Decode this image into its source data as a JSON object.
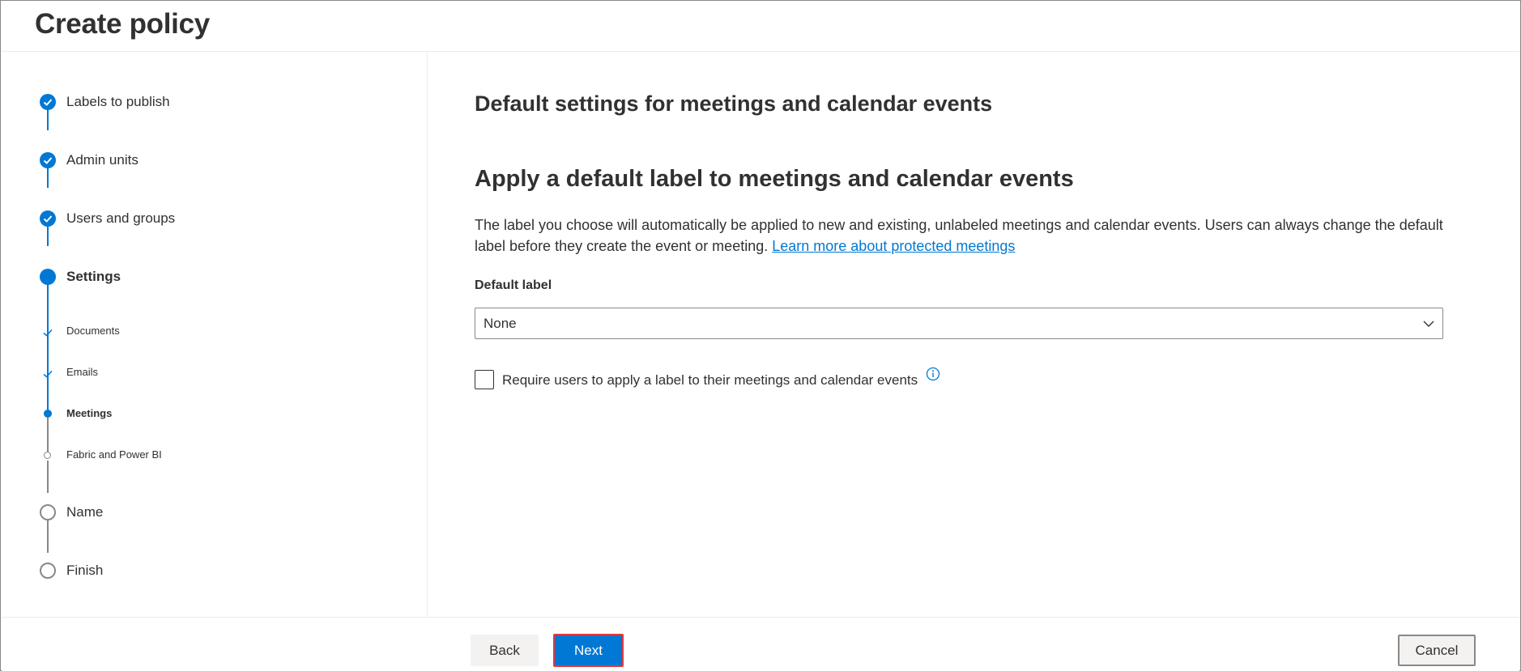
{
  "header": {
    "title": "Create policy"
  },
  "wizard": {
    "steps": [
      {
        "label": "Labels to publish",
        "state": "completed"
      },
      {
        "label": "Admin units",
        "state": "completed"
      },
      {
        "label": "Users and groups",
        "state": "completed"
      },
      {
        "label": "Settings",
        "state": "current"
      },
      {
        "label": "Documents",
        "state": "sub-completed"
      },
      {
        "label": "Emails",
        "state": "sub-completed"
      },
      {
        "label": "Meetings",
        "state": "sub-current"
      },
      {
        "label": "Fabric and Power BI",
        "state": "sub-pending"
      },
      {
        "label": "Name",
        "state": "pending"
      },
      {
        "label": "Finish",
        "state": "pending"
      }
    ]
  },
  "main": {
    "page_heading": "Default settings for meetings and calendar events",
    "section_heading": "Apply a default label to meetings and calendar events",
    "description": "The label you choose will automatically be applied to new and existing, unlabeled meetings and calendar events. Users can always change the default label before they create the event or meeting.",
    "learn_more_link": "Learn more about protected meetings",
    "default_label": {
      "label": "Default label",
      "value": "None"
    },
    "require_checkbox": {
      "label": "Require users to apply a label to their meetings and calendar events",
      "checked": false
    }
  },
  "footer": {
    "back_label": "Back",
    "next_label": "Next",
    "cancel_label": "Cancel"
  },
  "colors": {
    "accent": "#0078d4",
    "highlight_border": "#e0383e",
    "pending_grey": "#8a8886"
  }
}
